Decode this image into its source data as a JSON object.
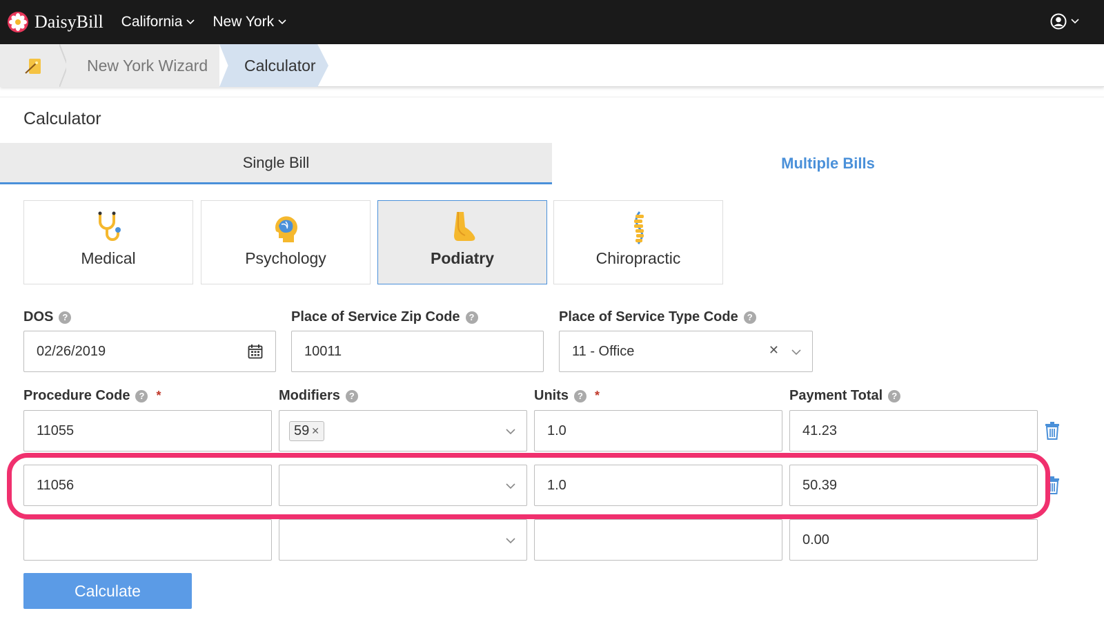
{
  "nav": {
    "brand": "DaisyBill",
    "items": [
      {
        "label": "California"
      },
      {
        "label": "New York"
      }
    ]
  },
  "breadcrumb": {
    "wizard": "New York Wizard",
    "current": "Calculator"
  },
  "page": {
    "title": "Calculator"
  },
  "tabs": {
    "single": "Single Bill",
    "multiple": "Multiple Bills"
  },
  "specialties": [
    {
      "label": "Medical",
      "icon": "stethoscope-icon"
    },
    {
      "label": "Psychology",
      "icon": "brain-icon"
    },
    {
      "label": "Podiatry",
      "icon": "foot-icon",
      "selected": true
    },
    {
      "label": "Chiropractic",
      "icon": "spine-icon"
    }
  ],
  "form": {
    "dos_label": "DOS",
    "dos_value": "02/26/2019",
    "zip_label": "Place of Service Zip Code",
    "zip_value": "10011",
    "type_label": "Place of Service Type Code",
    "type_value": "11 - Office",
    "proc_label": "Procedure Code",
    "mod_label": "Modifiers",
    "units_label": "Units",
    "pay_label": "Payment Total",
    "rows": [
      {
        "procedure": "11055",
        "modifier": "59",
        "units": "1.0",
        "payment": "41.23"
      },
      {
        "procedure": "11056",
        "modifier": "",
        "units": "1.0",
        "payment": "50.39"
      },
      {
        "procedure": "",
        "modifier": "",
        "units": "",
        "payment": "0.00"
      }
    ],
    "required_mark": "*",
    "help_mark": "?"
  },
  "actions": {
    "calculate": "Calculate"
  },
  "colors": {
    "accent": "#4a90d9",
    "highlight": "#f0306e",
    "button": "#5b9be6"
  }
}
